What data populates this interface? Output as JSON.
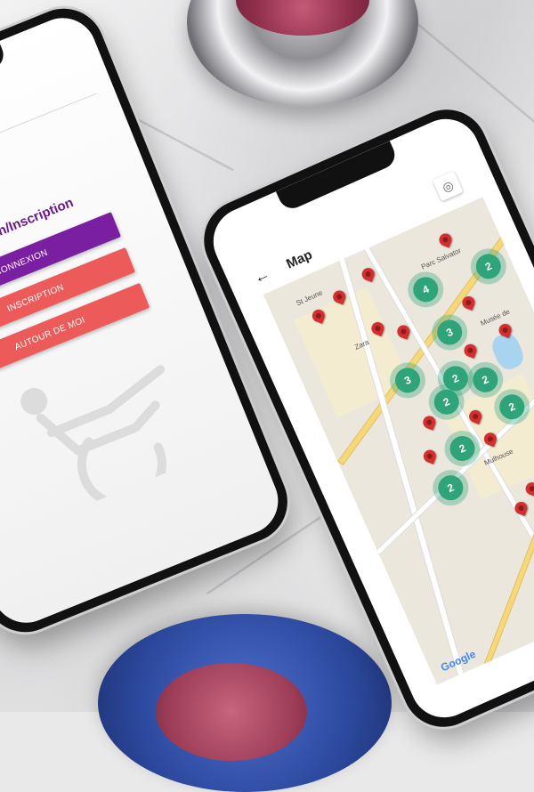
{
  "login_screen": {
    "title": "Connexion/Inscription",
    "buttons": {
      "connexion": "CONNEXION",
      "inscription": "INSCRIPTION",
      "autour": "AUTOUR DE MOI"
    },
    "colors": {
      "primary": "#7b1fa2",
      "accent": "#ec5a5a"
    },
    "illustration": "wheelchair-icon"
  },
  "map_screen": {
    "title": "Map",
    "back_icon": "arrow-left-icon",
    "locate_icon": "locate-icon",
    "labels": {
      "jeune": "St Jeune",
      "zara": "Zara",
      "salvator": "Parc Salvator",
      "musee": "Musée de",
      "mulhouse": "Mulhouse",
      "google": "Google"
    },
    "clusters": [
      "4",
      "3",
      "3",
      "2",
      "2",
      "2",
      "2",
      "2",
      "2",
      "2"
    ],
    "cluster_color": "#2fa37a",
    "pin_color": "#d32f2f"
  }
}
